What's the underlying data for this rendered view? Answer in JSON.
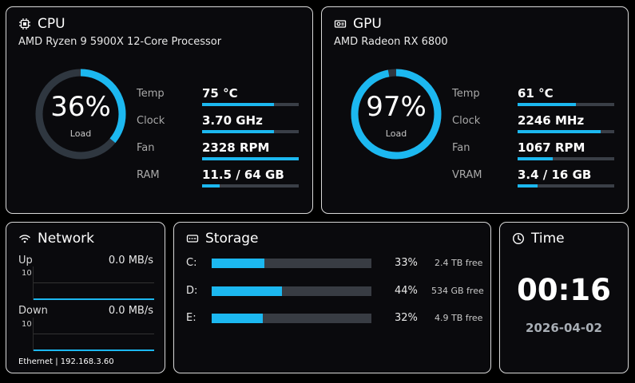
{
  "cpu": {
    "title": "CPU",
    "icon": "cpu-icon",
    "model": "AMD Ryzen 9 5900X 12-Core Processor",
    "load": {
      "value": "36%",
      "label": "Load",
      "fraction": 0.36
    },
    "metrics": [
      {
        "label": "Temp",
        "value": "75 °C",
        "fraction": 0.74
      },
      {
        "label": "Clock",
        "value": "3.70 GHz",
        "fraction": 0.74
      },
      {
        "label": "Fan",
        "value": "2328 RPM",
        "fraction": 1.0
      },
      {
        "label": "RAM",
        "value": "11.5 / 64 GB",
        "fraction": 0.18
      }
    ]
  },
  "gpu": {
    "title": "GPU",
    "icon": "gpu-icon",
    "model": "AMD Radeon RX 6800",
    "load": {
      "value": "97%",
      "label": "Load",
      "fraction": 0.97
    },
    "metrics": [
      {
        "label": "Temp",
        "value": "61 °C",
        "fraction": 0.6
      },
      {
        "label": "Clock",
        "value": "2246 MHz",
        "fraction": 0.86
      },
      {
        "label": "Fan",
        "value": "1067 RPM",
        "fraction": 0.36
      },
      {
        "label": "VRAM",
        "value": "3.4 / 16 GB",
        "fraction": 0.21
      }
    ]
  },
  "network": {
    "title": "Network",
    "icon": "wifi-icon",
    "up": {
      "label": "Up",
      "value": "0.0 MB/s",
      "scale": "10"
    },
    "down": {
      "label": "Down",
      "value": "0.0 MB/s",
      "scale": "10"
    },
    "footer": "Ethernet | 192.168.3.60"
  },
  "storage": {
    "title": "Storage",
    "icon": "drive-icon",
    "drives": [
      {
        "label": "C:",
        "percent": "33%",
        "free": "2.4 TB free",
        "fraction": 0.33
      },
      {
        "label": "D:",
        "percent": "44%",
        "free": "534 GB free",
        "fraction": 0.44
      },
      {
        "label": "E:",
        "percent": "32%",
        "free": "4.9 TB free",
        "fraction": 0.32
      }
    ]
  },
  "time": {
    "title": "Time",
    "icon": "clock-icon",
    "clock": "00:16",
    "date": "2026-04-02"
  },
  "colors": {
    "accent": "#1cb8f0",
    "track": "#2f3740",
    "card_bg": "#0a0a0d",
    "border": "#d8d8d8"
  }
}
